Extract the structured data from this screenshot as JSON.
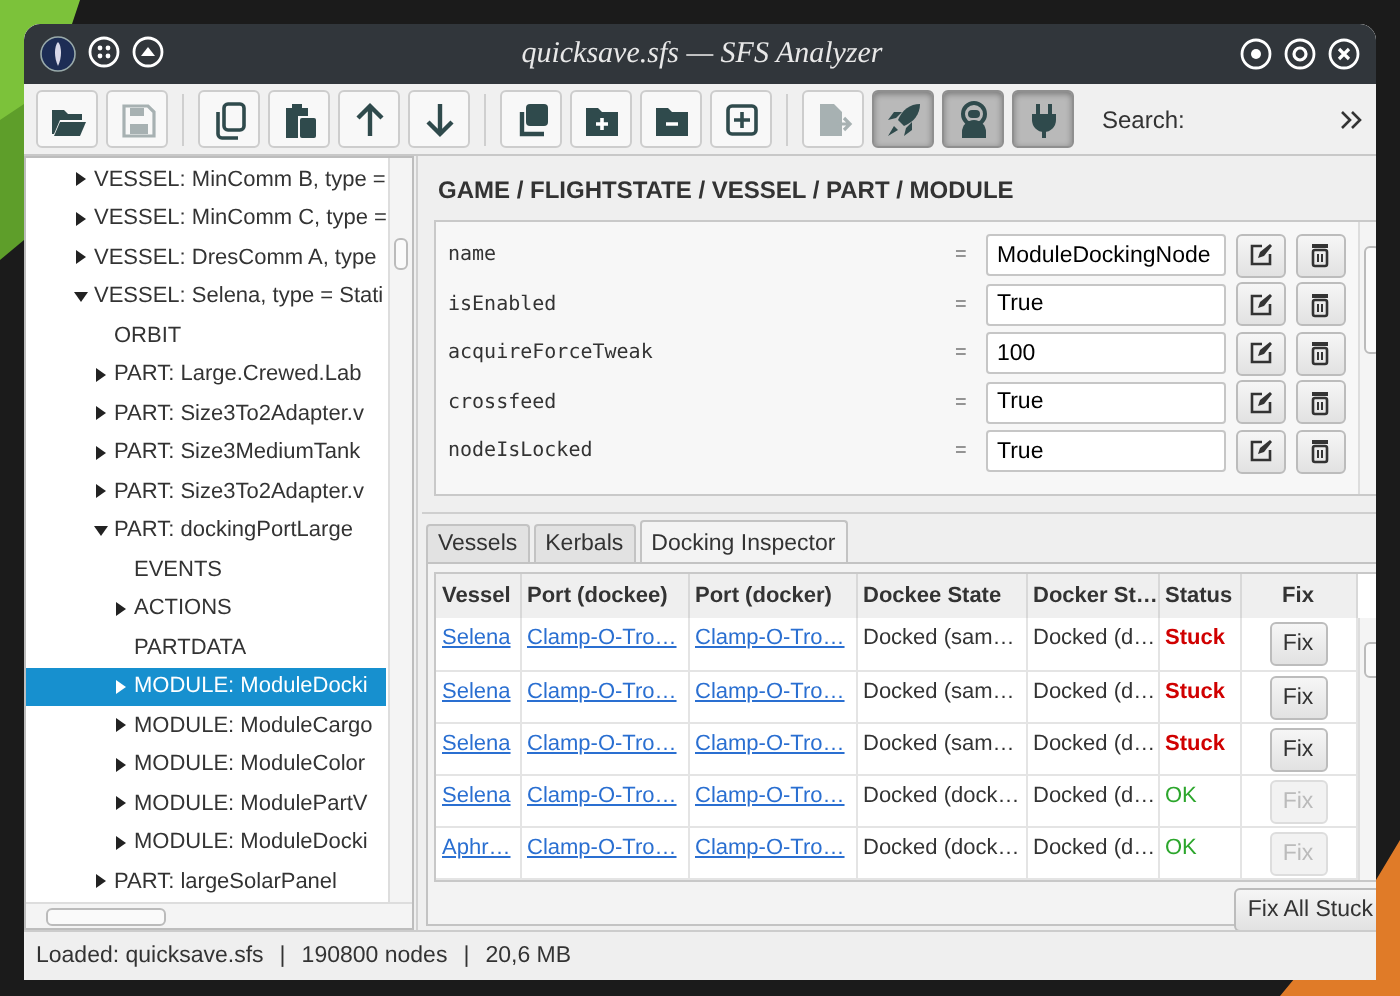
{
  "window": {
    "title": "quicksave.sfs — SFS Analyzer"
  },
  "toolbar": {
    "groups": [
      [
        {
          "kind": "folder-open",
          "disabled": false,
          "pressed": false
        },
        {
          "kind": "save",
          "disabled": true,
          "pressed": false
        }
      ],
      [
        {
          "kind": "copy",
          "disabled": false,
          "pressed": false
        },
        {
          "kind": "paste",
          "disabled": false,
          "pressed": false
        },
        {
          "kind": "up",
          "disabled": false,
          "pressed": false
        },
        {
          "kind": "down",
          "disabled": false,
          "pressed": false
        }
      ],
      [
        {
          "kind": "duplicate",
          "disabled": false,
          "pressed": false
        },
        {
          "kind": "folder-plus",
          "disabled": false,
          "pressed": false
        },
        {
          "kind": "folder-minus",
          "disabled": false,
          "pressed": false
        },
        {
          "kind": "square-plus",
          "disabled": false,
          "pressed": false
        }
      ],
      [
        {
          "kind": "export",
          "disabled": true,
          "pressed": false
        },
        {
          "kind": "rocket",
          "disabled": false,
          "pressed": true
        },
        {
          "kind": "astronaut",
          "disabled": false,
          "pressed": true
        },
        {
          "kind": "plug",
          "disabled": false,
          "pressed": true
        }
      ]
    ],
    "search_label": "Search:"
  },
  "tree": {
    "items": [
      {
        "label": "VESSEL: MinComm B, type =",
        "expandable": true,
        "expanded": false,
        "selected": false
      },
      {
        "label": "VESSEL: MinComm C, type =",
        "expandable": true,
        "expanded": false,
        "selected": false
      },
      {
        "label": "VESSEL: DresComm A, type",
        "expandable": true,
        "expanded": false,
        "selected": false
      },
      {
        "label": "VESSEL: Selena, type = Stati",
        "expandable": true,
        "expanded": true,
        "selected": false,
        "children": [
          {
            "label": "ORBIT",
            "expandable": false,
            "expanded": false,
            "selected": false
          },
          {
            "label": "PART: Large.Crewed.Lab",
            "expandable": true,
            "expanded": false,
            "selected": false
          },
          {
            "label": "PART: Size3To2Adapter.v",
            "expandable": true,
            "expanded": false,
            "selected": false
          },
          {
            "label": "PART: Size3MediumTank",
            "expandable": true,
            "expanded": false,
            "selected": false
          },
          {
            "label": "PART: Size3To2Adapter.v",
            "expandable": true,
            "expanded": false,
            "selected": false
          },
          {
            "label": "PART: dockingPortLarge",
            "expandable": true,
            "expanded": true,
            "selected": false,
            "children": [
              {
                "label": "EVENTS",
                "expandable": false,
                "expanded": false,
                "selected": false
              },
              {
                "label": "ACTIONS",
                "expandable": true,
                "expanded": false,
                "selected": false
              },
              {
                "label": "PARTDATA",
                "expandable": false,
                "expanded": false,
                "selected": false
              },
              {
                "label": "MODULE: ModuleDocki",
                "expandable": true,
                "expanded": false,
                "selected": true
              },
              {
                "label": "MODULE: ModuleCargo",
                "expandable": true,
                "expanded": false,
                "selected": false
              },
              {
                "label": "MODULE: ModuleColor",
                "expandable": true,
                "expanded": false,
                "selected": false
              },
              {
                "label": "MODULE: ModulePartV",
                "expandable": true,
                "expanded": false,
                "selected": false
              },
              {
                "label": "MODULE: ModuleDocki",
                "expandable": true,
                "expanded": false,
                "selected": false
              }
            ]
          },
          {
            "label": "PART: largeSolarPanel",
            "expandable": true,
            "expanded": false,
            "selected": false
          }
        ]
      }
    ]
  },
  "editor": {
    "breadcrumb": "GAME / FLIGHTSTATE / VESSEL / PART / MODULE",
    "fields": [
      {
        "key": "name",
        "equals": "=",
        "value": "ModuleDockingNode"
      },
      {
        "key": "isEnabled",
        "equals": "=",
        "value": "True"
      },
      {
        "key": "acquireForceTweak",
        "equals": "=",
        "value": "100"
      },
      {
        "key": "crossfeed",
        "equals": "=",
        "value": "True"
      },
      {
        "key": "nodeIsLocked",
        "equals": "=",
        "value": "True"
      }
    ]
  },
  "tabs": [
    {
      "label": "Vessels",
      "selected": false
    },
    {
      "label": "Kerbals",
      "selected": false
    },
    {
      "label": "Docking Inspector",
      "selected": true
    }
  ],
  "table": {
    "columns": [
      "Vessel",
      "Port (dockee)",
      "Port (docker)",
      "Dockee State",
      "Docker St…",
      "Status",
      "Fix"
    ],
    "rows": [
      {
        "vessel": "Selena",
        "port_dockee": "Clamp-O-Tro…",
        "port_docker": "Clamp-O-Tro…",
        "dockee_state": "Docked (sam…",
        "docker_state": "Docked (d…",
        "status": "Stuck",
        "stuck": true,
        "fix": "Fix",
        "fix_disabled": false
      },
      {
        "vessel": "Selena",
        "port_dockee": "Clamp-O-Tro…",
        "port_docker": "Clamp-O-Tro…",
        "dockee_state": "Docked (sam…",
        "docker_state": "Docked (d…",
        "status": "Stuck",
        "stuck": true,
        "fix": "Fix",
        "fix_disabled": false
      },
      {
        "vessel": "Selena",
        "port_dockee": "Clamp-O-Tro…",
        "port_docker": "Clamp-O-Tro…",
        "dockee_state": "Docked (sam…",
        "docker_state": "Docked (d…",
        "status": "Stuck",
        "stuck": true,
        "fix": "Fix",
        "fix_disabled": false
      },
      {
        "vessel": "Selena",
        "port_dockee": "Clamp-O-Tro…",
        "port_docker": "Clamp-O-Tro…",
        "dockee_state": "Docked (dock…",
        "docker_state": "Docked (d…",
        "status": "OK",
        "stuck": false,
        "fix": "Fix",
        "fix_disabled": true
      },
      {
        "vessel": "Aphr…",
        "port_dockee": "Clamp-O-Tro…",
        "port_docker": "Clamp-O-Tro…",
        "dockee_state": "Docked (dock…",
        "docker_state": "Docked (d…",
        "status": "OK",
        "stuck": false,
        "fix": "Fix",
        "fix_disabled": true
      }
    ]
  },
  "fix_all_button": "Fix All Stuck",
  "status_bar": {
    "segments": [
      "Loaded: quicksave.sfs",
      "190800 nodes",
      "20,6 MB"
    ],
    "separator": "|"
  }
}
